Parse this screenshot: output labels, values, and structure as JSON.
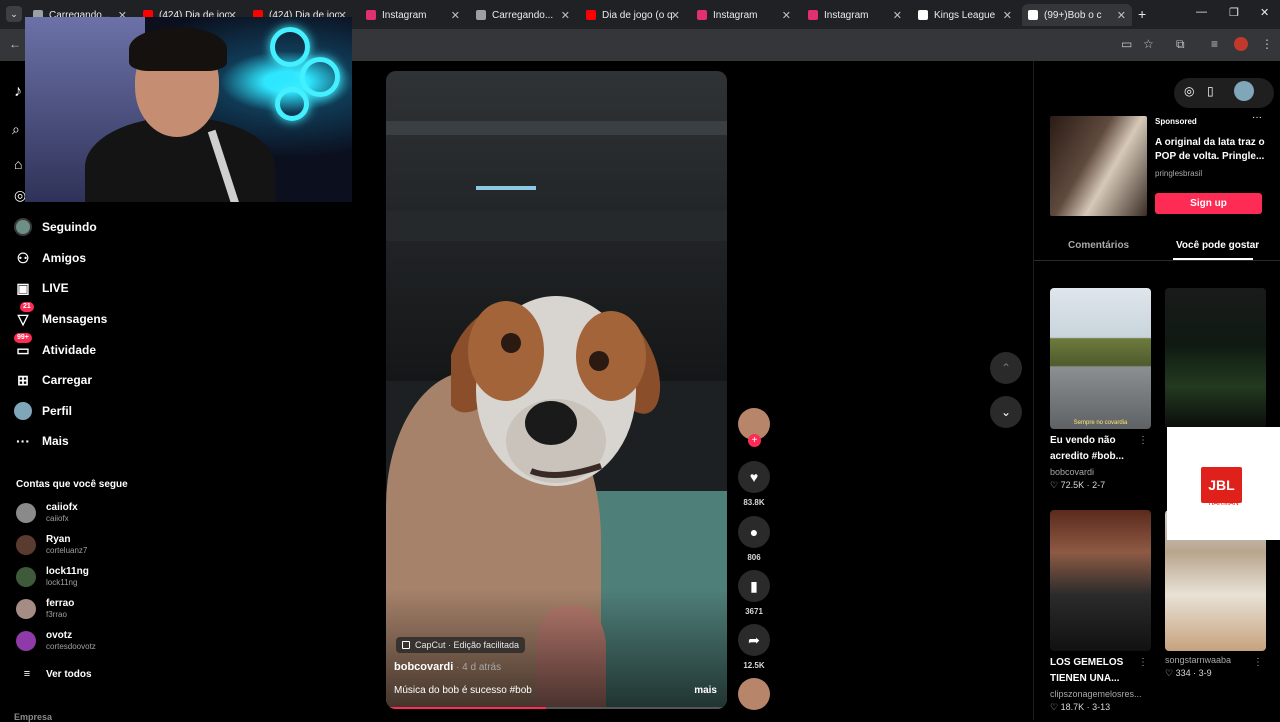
{
  "browser": {
    "tabs": [
      {
        "title": "Carregando...",
        "favicon_color": "#9aa0a6"
      },
      {
        "title": "(424) Dia de jogo",
        "favicon_color": "#ff0000"
      },
      {
        "title": "(424) Dia de jogo",
        "favicon_color": "#ff0000"
      },
      {
        "title": "Instagram",
        "favicon_color": "#e1306c"
      },
      {
        "title": "Carregando...",
        "favicon_color": "#9aa0a6"
      },
      {
        "title": "Dia de jogo (o qu",
        "favicon_color": "#ff0000"
      },
      {
        "title": "Instagram",
        "favicon_color": "#e1306c"
      },
      {
        "title": "Instagram",
        "favicon_color": "#e1306c"
      },
      {
        "title": "Kings League",
        "favicon_color": "#ffffff"
      },
      {
        "title": "(99+)Bob o c",
        "favicon_color": "#ffffff"
      }
    ],
    "new_tab": "+"
  },
  "sidebar": {
    "items": [
      {
        "label": "Seguindo",
        "icon": "following-avatar-icon"
      },
      {
        "label": "Amigos",
        "icon": "friends-icon"
      },
      {
        "label": "LIVE",
        "icon": "live-icon"
      },
      {
        "label": "Mensagens",
        "icon": "messages-icon",
        "badge": "21"
      },
      {
        "label": "Atividade",
        "icon": "activity-icon",
        "badge": "99+"
      },
      {
        "label": "Carregar",
        "icon": "upload-icon"
      },
      {
        "label": "Perfil",
        "icon": "profile-avatar-icon"
      },
      {
        "label": "Mais",
        "icon": "more-icon"
      }
    ],
    "following_title": "Contas que você segue",
    "accounts": [
      {
        "name": "caiiofx",
        "handle": "caiiofx"
      },
      {
        "name": "Ryan",
        "handle": "corteluanz7"
      },
      {
        "name": "lock11ng",
        "handle": "lock11ng"
      },
      {
        "name": "ferrao",
        "handle": "f3rrao"
      },
      {
        "name": "ovotz",
        "handle": "cortesdoovotz"
      }
    ],
    "see_all": "Ver todos",
    "footer": "Empresa"
  },
  "video": {
    "capcut_label": "CapCut · Edição facilitada",
    "author": "bobcovardi",
    "time": " · 4 d atrás",
    "description": "Música do bob é sucesso #bob",
    "more": "mais",
    "progress": 0.47
  },
  "actions": {
    "likes": "83.8K",
    "comments": "806",
    "saves": "3671",
    "shares": "12.5K"
  },
  "right": {
    "ad": {
      "sponsored": "Sponsored",
      "title": "A original da lata traz o POP de volta. Pringle...",
      "brand": "pringlesbrasil",
      "cta": "Sign up"
    },
    "tabs": [
      "Comentários",
      "Você pode gostar"
    ],
    "cards": [
      {
        "title": "Eu vendo não acredito #bob...",
        "author": "bobcovardi",
        "stats": "♡ 72.5K · 2-7",
        "caption": "Sempre no covardia"
      },
      {
        "title": "",
        "author": "",
        "stats": "",
        "caption": ""
      },
      {
        "title": "LOS GEMELOS TIENEN UNA...",
        "author": "clipszonagemelosres...",
        "stats": "♡ 18.7K · 3-13",
        "caption": ""
      },
      {
        "title": "",
        "author": "songstarnwaaba",
        "stats": "♡ 334 · 3-9",
        "caption": ""
      }
    ]
  },
  "overlay_ad": {
    "brand": "JBL",
    "sub": "HARMAN"
  },
  "colors": {
    "accent": "#fe2c55",
    "bg": "#000000"
  }
}
